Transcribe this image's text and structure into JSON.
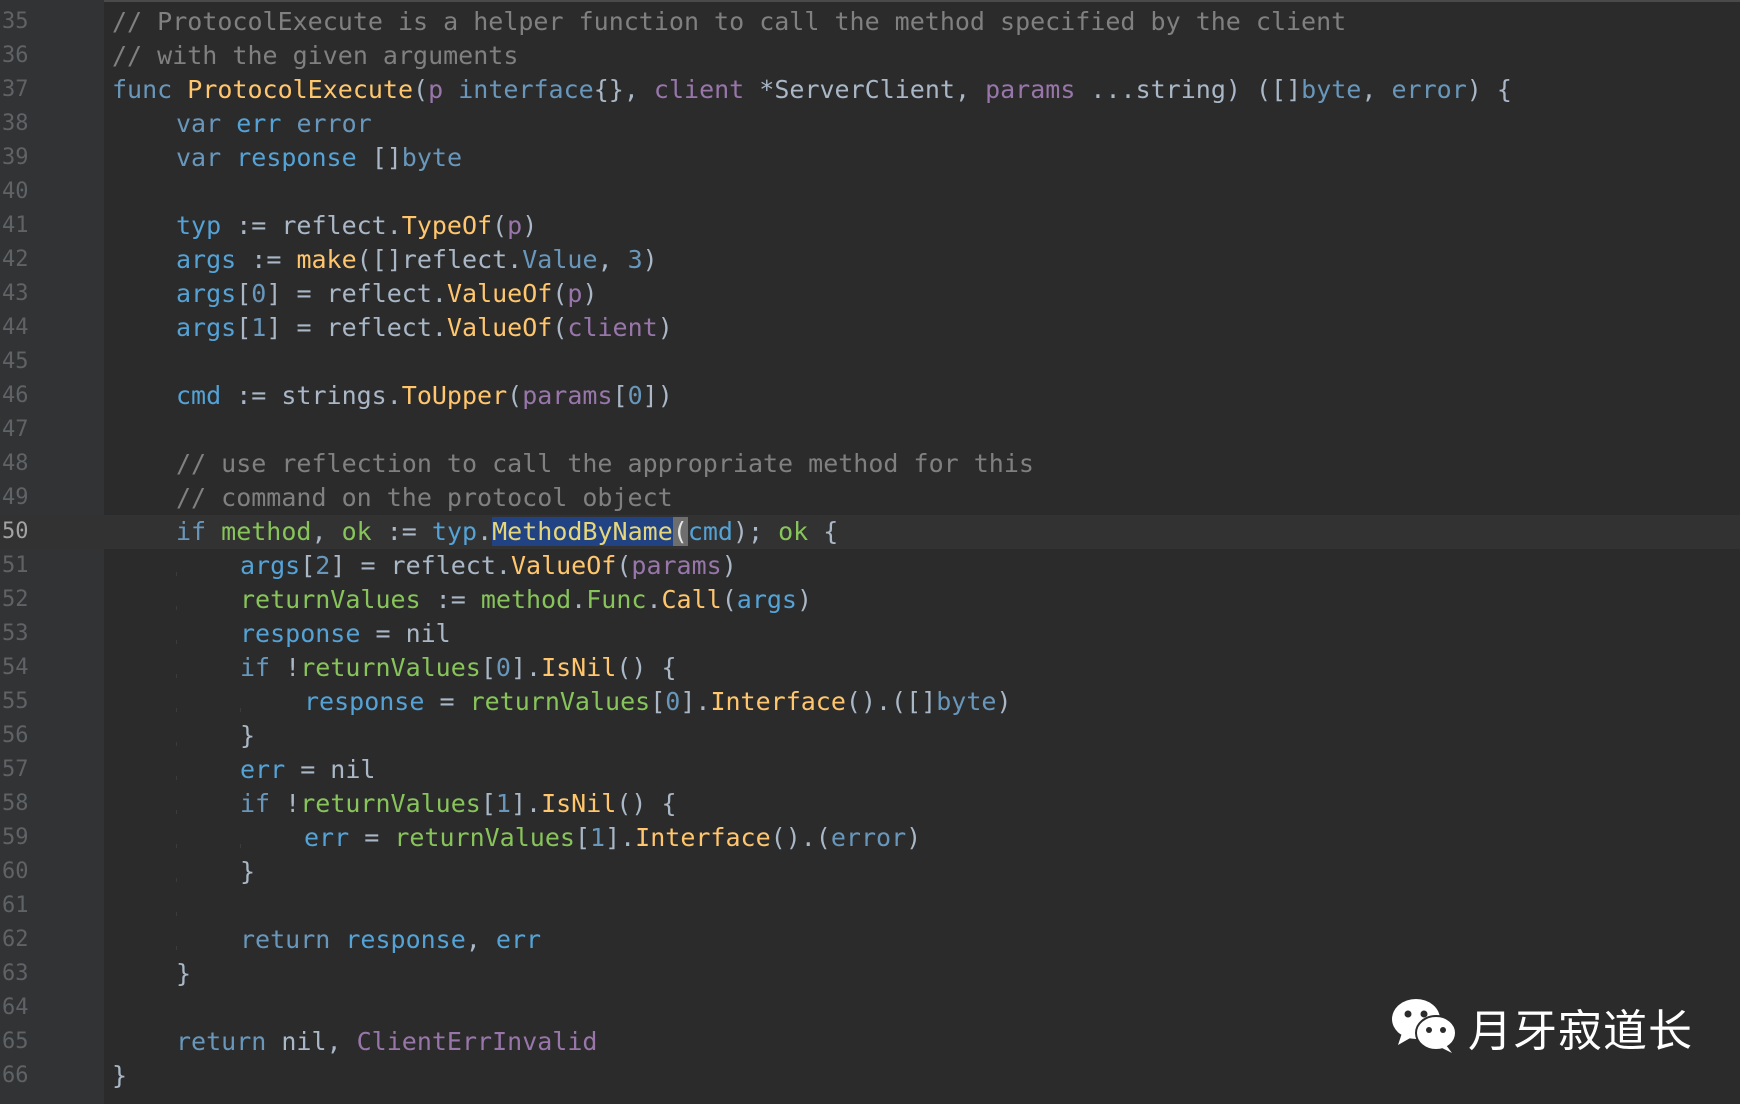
{
  "editor": {
    "lines": [
      {
        "num": "35",
        "text": "// ProtocolExecute is a helper function to call the method specified by the client"
      },
      {
        "num": "36",
        "text": "// with the given arguments"
      },
      {
        "num": "37",
        "text": "func ProtocolExecute(p interface{}, client *ServerClient, params ...string) ([]byte, error) {"
      },
      {
        "num": "38",
        "text": "var err error"
      },
      {
        "num": "39",
        "text": "var response []byte"
      },
      {
        "num": "40",
        "text": ""
      },
      {
        "num": "41",
        "text": "typ := reflect.TypeOf(p)"
      },
      {
        "num": "42",
        "text": "args := make([]reflect.Value, 3)"
      },
      {
        "num": "43",
        "text": "args[0] = reflect.ValueOf(p)"
      },
      {
        "num": "44",
        "text": "args[1] = reflect.ValueOf(client)"
      },
      {
        "num": "45",
        "text": ""
      },
      {
        "num": "46",
        "text": "cmd := strings.ToUpper(params[0])"
      },
      {
        "num": "47",
        "text": ""
      },
      {
        "num": "48",
        "text": "// use reflection to call the appropriate method for this"
      },
      {
        "num": "49",
        "text": "// command on the protocol object"
      },
      {
        "num": "50",
        "text": "if method, ok := typ.MethodByName(cmd); ok {"
      },
      {
        "num": "51",
        "text": "args[2] = reflect.ValueOf(params)"
      },
      {
        "num": "52",
        "text": "returnValues := method.Func.Call(args)"
      },
      {
        "num": "53",
        "text": "response = nil"
      },
      {
        "num": "54",
        "text": "if !returnValues[0].IsNil() {"
      },
      {
        "num": "55",
        "text": "response = returnValues[0].Interface().([]byte)"
      },
      {
        "num": "56",
        "text": "}"
      },
      {
        "num": "57",
        "text": "err = nil"
      },
      {
        "num": "58",
        "text": "if !returnValues[1].IsNil() {"
      },
      {
        "num": "59",
        "text": "err = returnValues[1].Interface().(error)"
      },
      {
        "num": "60",
        "text": "}"
      },
      {
        "num": "61",
        "text": ""
      },
      {
        "num": "62",
        "text": "return response, err"
      },
      {
        "num": "63",
        "text": "}"
      },
      {
        "num": "64",
        "text": ""
      },
      {
        "num": "65",
        "text": "return nil, ClientErrInvalid"
      },
      {
        "num": "66",
        "text": "}"
      }
    ],
    "current_line": "50",
    "selection": "MethodByName"
  },
  "watermark": {
    "text": "月牙寂道长",
    "icon": "wechat-icon"
  },
  "colors": {
    "background": "#2b2b2b",
    "gutter": "#313335",
    "comment": "#808080",
    "function": "#ffc66d",
    "keyword": "#6897bb",
    "parameter": "#9876aa",
    "selection": "#214283"
  }
}
